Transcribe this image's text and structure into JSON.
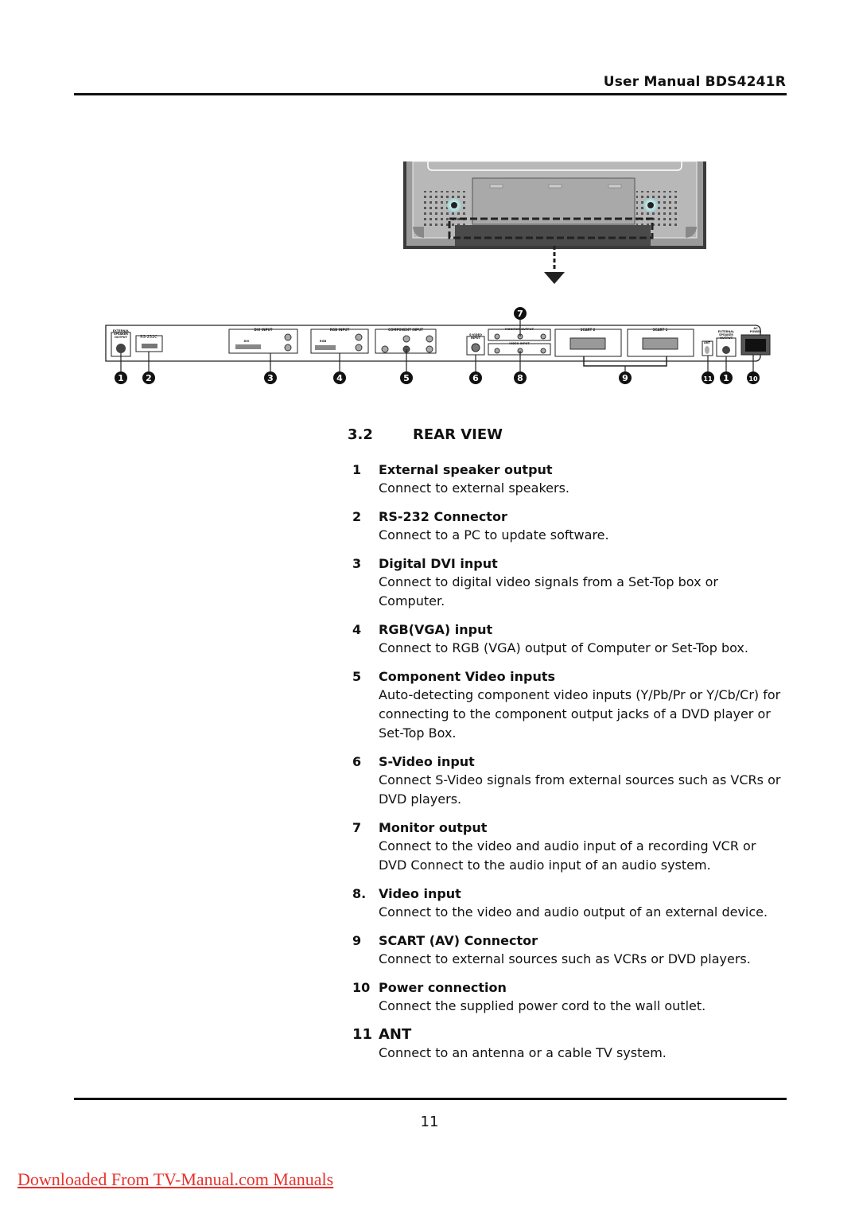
{
  "header": {
    "title": "User Manual BDS4241R"
  },
  "figure": {
    "panel_labels": {
      "ext_speaker_left": [
        "EXTERNAL",
        "SPEAKER",
        "OUTPUT",
        "R"
      ],
      "rs232": "RS-232C",
      "dvi_group": "DVI INPUT",
      "dvi_port": "DVI",
      "rgb_group": "RGB INPUT",
      "rgb_port": "RGB",
      "audio_l": "L",
      "audio_r": "R",
      "component_group": "COMPONENT INPUT",
      "component_y": "Y",
      "component_pb": "Pb/Cb",
      "component_pr": "Pr/Cr",
      "svideo": [
        "S-VIDEO",
        "INPUT"
      ],
      "monitor_output": "MONITOR OUTPUT",
      "video_input": "VIDEO INPUT",
      "video": "VIDEO",
      "scart2": "SCART 2",
      "scart1": "SCART 1",
      "ant": "ANT",
      "ext_speaker_right": [
        "EXTERNAL",
        "SPEAKER",
        "OUTPUT"
      ],
      "ac_power": [
        "AC",
        "POWER"
      ]
    },
    "callouts": [
      "1",
      "2",
      "3",
      "4",
      "5",
      "6",
      "7",
      "8",
      "9",
      "11",
      "1",
      "10"
    ]
  },
  "section": {
    "number": "3.2",
    "title": "REAR VIEW"
  },
  "items": [
    {
      "num": "1",
      "title": "External speaker output",
      "desc": "Connect to external speakers."
    },
    {
      "num": "2",
      "title": "RS-232 Connector",
      "desc": "Connect to a PC to update software."
    },
    {
      "num": "3",
      "title": "Digital DVI input",
      "desc": "Connect to digital video signals from a Set-Top box or Computer."
    },
    {
      "num": "4",
      "title": "RGB(VGA) input",
      "desc": "Connect to RGB (VGA) output of Computer or Set-Top box."
    },
    {
      "num": "5",
      "title": "Component Video inputs",
      "desc": "Auto-detecting component video inputs (Y/Pb/Pr or Y/Cb/Cr) for connecting to the component output jacks of a DVD player or Set-Top Box."
    },
    {
      "num": "6",
      "title": "S-Video input",
      "desc": "Connect S-Video signals from external sources such as VCRs or DVD players."
    },
    {
      "num": "7",
      "title": "Monitor output",
      "desc": "Connect to the video and audio input of a recording VCR or DVD Connect to the audio input of an audio system."
    },
    {
      "num": "8.",
      "title": "Video input",
      "desc": "Connect to the video and audio output of an external device."
    },
    {
      "num": "9",
      "title": "SCART (AV) Connector",
      "desc": "Connect to external sources such as VCRs or DVD players."
    },
    {
      "num": "10",
      "title": "Power connection",
      "desc": "Connect the supplied power cord to the wall outlet."
    },
    {
      "num": "11",
      "title": "ANT",
      "desc": "Connect to an antenna or a cable TV system."
    }
  ],
  "footer": {
    "page_number": "11",
    "download_link": "Downloaded From TV-Manual.com Manuals"
  }
}
